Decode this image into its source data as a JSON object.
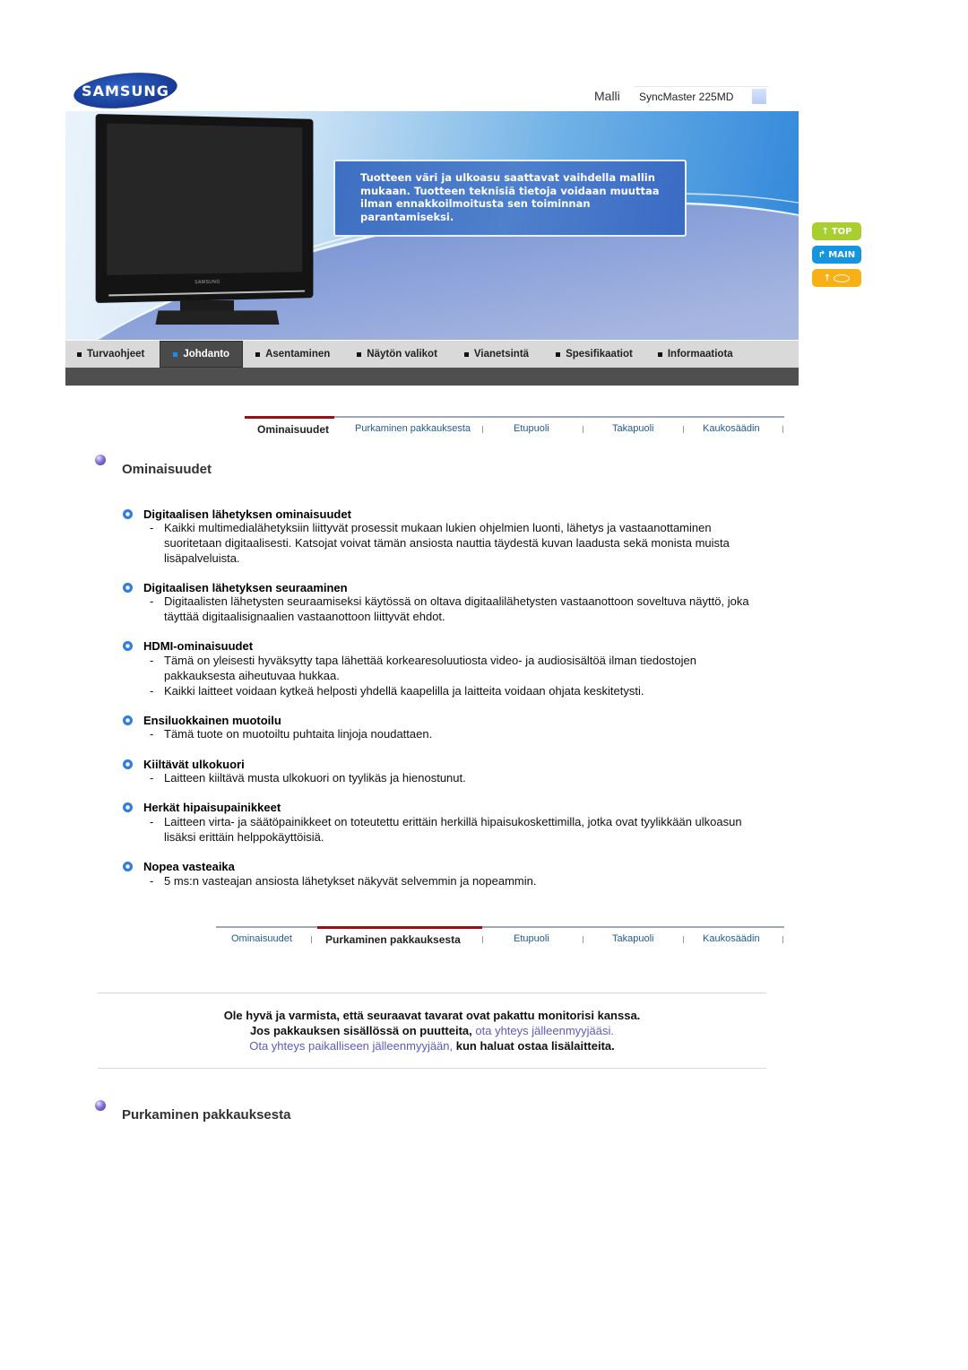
{
  "header": {
    "brand": "SAMSUNG",
    "model_label": "Malli",
    "model_value": "SyncMaster 225MD"
  },
  "banner": {
    "monitor_brand": "SAMSUNG",
    "notice": "Tuotteen väri ja ulkoasu saattavat vaihdella mallin\nmukaan. Tuotteen teknisiä tietoja voidaan muuttaa\nilman ennakkoilmoitusta sen toiminnan\nparantamiseksi."
  },
  "side_buttons": [
    {
      "label": "TOP",
      "icon": "arrow-up-icon",
      "color": "#a8cf2f"
    },
    {
      "label": "MAIN",
      "icon": "arrow-bend-up-icon",
      "color": "#1595dd"
    },
    {
      "label": "",
      "icon": "lips-icon",
      "color": "#f7b116"
    }
  ],
  "main_nav": {
    "items": [
      {
        "label": "Turvaohjeet",
        "active": false
      },
      {
        "label": "Johdanto",
        "active": true
      },
      {
        "label": "Asentaminen",
        "active": false
      },
      {
        "label": "Näytön valikot",
        "active": false
      },
      {
        "label": "Vianetsintä",
        "active": false
      },
      {
        "label": "Spesifikaatiot",
        "active": false
      },
      {
        "label": "Informaatiota",
        "active": false
      }
    ]
  },
  "sub_nav": {
    "tabs": [
      "Ominaisuudet",
      "Purkaminen pakkauksesta",
      "Etupuoli",
      "Takapuoli",
      "Kaukosäädin"
    ],
    "accent_color": "#9b0e13"
  },
  "section1": {
    "title": "Ominaisuudet",
    "features": [
      {
        "heading": "Digitaalisen lähetyksen ominaisuudet",
        "bullets": [
          "Kaikki multimedialähetyksiin liittyvät prosessit mukaan lukien ohjelmien luonti, lähetys ja vastaanottaminen suoritetaan digitaalisesti. Katsojat voivat tämän ansiosta nauttia täydestä kuvan laadusta sekä monista muista lisäpalveluista."
        ]
      },
      {
        "heading": "Digitaalisen lähetyksen seuraaminen",
        "bullets": [
          "Digitaalisten lähetysten seuraamiseksi käytössä on oltava digitaalilähetysten vastaanottoon soveltuva näyttö, joka täyttää digitaalisignaalien vastaanottoon liittyvät ehdot."
        ]
      },
      {
        "heading": "HDMI-ominaisuudet",
        "bullets": [
          "Tämä on yleisesti hyväksytty tapa lähettää korkearesoluutiosta video- ja audiosisältöä ilman tiedostojen pakkauksesta aiheutuvaa hukkaa.",
          "Kaikki laitteet voidaan kytkeä helposti yhdellä kaapelilla ja laitteita voidaan ohjata keskitetysti."
        ]
      },
      {
        "heading": "Ensiluokkainen muotoilu",
        "bullets": [
          "Tämä tuote on muotoiltu puhtaita linjoja noudattaen."
        ]
      },
      {
        "heading": "Kiiltävät ulkokuori",
        "bullets": [
          "Laitteen kiiltävä musta ulkokuori on tyylikäs ja hienostunut."
        ]
      },
      {
        "heading": "Herkät hipaisupainikkeet",
        "bullets": [
          "Laitteen virta- ja säätöpainikkeet on toteutettu erittäin herkillä hipaisukoskettimilla, jotka ovat tyylikkään ulkoasun lisäksi erittäin helppokäyttöisiä."
        ]
      },
      {
        "heading": "Nopea vasteaika",
        "bullets": [
          "5 ms:n vasteajan ansiosta lähetykset näkyvät selvemmin ja nopeammin."
        ]
      }
    ]
  },
  "pack_note": {
    "line1": "Ole hyvä ja varmista, että seuraavat tavarat ovat pakattu monitorisi kanssa.",
    "line2_text": "Jos pakkauksen sisällössä on puutteita, ",
    "line2_link": "ota yhteys jälleenmyyjääsi.",
    "line3_link": "Ota yhteys paikalliseen jälleenmyyjään,",
    "line3_text": " kun haluat ostaa lisälaitteita.",
    "link_color": "#5b5bc0"
  },
  "section2": {
    "title": "Purkaminen pakkauksesta"
  }
}
